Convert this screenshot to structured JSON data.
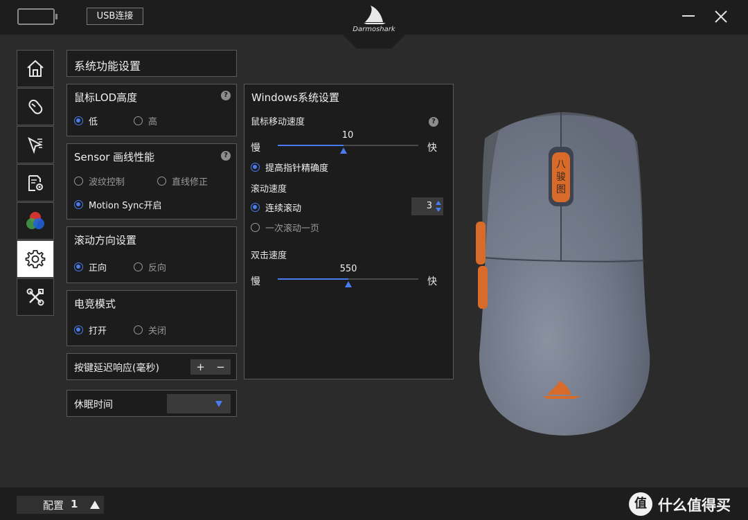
{
  "topbar": {
    "usb_label": "USB连接",
    "brand": "Darmoshark"
  },
  "sidebar": {
    "items": [
      {
        "name": "home-icon"
      },
      {
        "name": "mouse-icon"
      },
      {
        "name": "pointer-icon"
      },
      {
        "name": "document-settings-icon"
      },
      {
        "name": "rgb-icon"
      },
      {
        "name": "gear-icon",
        "active": true
      },
      {
        "name": "tools-icon"
      }
    ]
  },
  "system": {
    "title": "系统功能设置",
    "lod": {
      "title": "鼠标LOD高度",
      "low": "低",
      "high": "高"
    },
    "sensor": {
      "title": "Sensor 画线性能",
      "ripple": "波纹控制",
      "straight": "直线修正",
      "motion": "Motion Sync开启"
    },
    "scroll_dir": {
      "title": "滚动方向设置",
      "forward": "正向",
      "reverse": "反向"
    },
    "esports": {
      "title": "电竞模式",
      "on": "打开",
      "off": "关闭"
    },
    "debounce": {
      "title": "按键延迟响应(毫秒)",
      "plus": "+",
      "minus": "−"
    },
    "sleep": {
      "title": "休眠时间"
    }
  },
  "windows": {
    "title": "Windows系统设置",
    "speed": {
      "title": "鼠标移动速度",
      "value": "10",
      "slow": "慢",
      "fast": "快",
      "fraction": 0.47
    },
    "precision": "提高指针精确度",
    "scroll": {
      "title": "滚动速度",
      "continuous": "连续滚动",
      "continuous_value": "3",
      "page": "一次滚动一页"
    },
    "dblclick": {
      "title": "双击速度",
      "value": "550",
      "slow": "慢",
      "fast": "快",
      "fraction": 0.5
    }
  },
  "footer": {
    "profile_label": "配置",
    "profile_num": "1",
    "watermark": "什么值得买",
    "watermark_icon": "值"
  },
  "colors": {
    "accent": "#4a7cf0",
    "mouse_body": "#6b7384",
    "mouse_orange": "#d86a2a"
  }
}
